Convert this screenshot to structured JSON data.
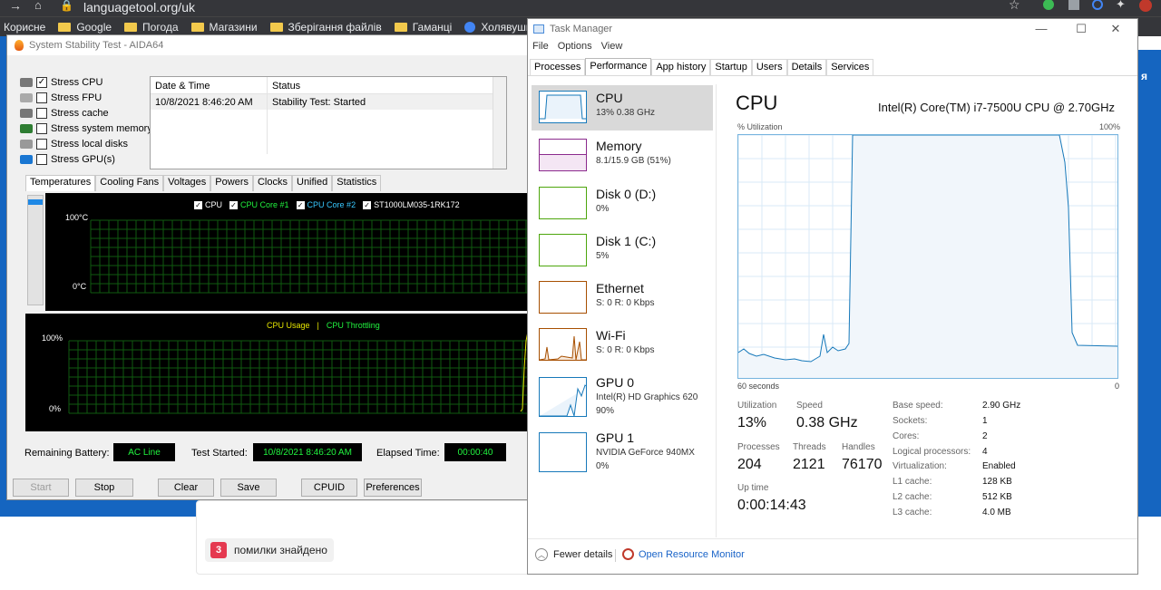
{
  "browser": {
    "url": "languagetool.org/uk",
    "bookmarks": [
      "Корисне",
      "Google",
      "Погода",
      "Магазини",
      "Зберігання файлів",
      "Гаманці",
      "Холявушка - Фор"
    ],
    "right_text": "я"
  },
  "languagetool": {
    "error_count": "3",
    "error_text": "помилки знайдено"
  },
  "aida": {
    "title": "System Stability Test - AIDA64",
    "stress": [
      {
        "label": "Stress CPU",
        "checked": true
      },
      {
        "label": "Stress FPU",
        "checked": false
      },
      {
        "label": "Stress cache",
        "checked": false
      },
      {
        "label": "Stress system memory",
        "checked": false
      },
      {
        "label": "Stress local disks",
        "checked": false
      },
      {
        "label": "Stress GPU(s)",
        "checked": false
      }
    ],
    "log": {
      "col_datetime": "Date & Time",
      "col_status": "Status",
      "row_datetime": "10/8/2021 8:46:20 AM",
      "row_status": "Stability Test: Started"
    },
    "tabs": [
      "Temperatures",
      "Cooling Fans",
      "Voltages",
      "Powers",
      "Clocks",
      "Unified",
      "Statistics"
    ],
    "temp_legend": [
      "CPU",
      "CPU Core #1",
      "CPU Core #2",
      "ST1000LM035-1RK172"
    ],
    "temp_axis": {
      "top": "100°C",
      "bottom": "0°C"
    },
    "usage_legend": {
      "usage": "CPU Usage",
      "sep": "|",
      "throttling": "CPU Throttling"
    },
    "usage_axis": {
      "top": "100%",
      "bottom": "0%"
    },
    "remaining_battery_label": "Remaining Battery:",
    "remaining_battery_value": "AC Line",
    "test_started_label": "Test Started:",
    "test_started_value": "10/8/2021 8:46:20 AM",
    "elapsed_label": "Elapsed Time:",
    "elapsed_value": "00:00:40",
    "buttons": {
      "start": "Start",
      "stop": "Stop",
      "clear": "Clear",
      "save": "Save",
      "cpuid": "CPUID",
      "preferences": "Preferences"
    }
  },
  "taskmanager": {
    "title": "Task Manager",
    "menu": [
      "File",
      "Options",
      "View"
    ],
    "tabs": [
      "Processes",
      "Performance",
      "App history",
      "Startup",
      "Users",
      "Details",
      "Services"
    ],
    "active_tab": "Performance",
    "sidebar": [
      {
        "name": "CPU",
        "sub": "13%  0.38 GHz",
        "color": "#1779ba"
      },
      {
        "name": "Memory",
        "sub": "8.1/15.9 GB (51%)",
        "color": "#8b2a8d"
      },
      {
        "name": "Disk 0 (D:)",
        "sub": "0%",
        "color": "#4da60c"
      },
      {
        "name": "Disk 1 (C:)",
        "sub": "5%",
        "color": "#4da60c"
      },
      {
        "name": "Ethernet",
        "sub": "S: 0 R: 0 Kbps",
        "color": "#a74f01"
      },
      {
        "name": "Wi-Fi",
        "sub": "S: 0 R: 0 Kbps",
        "color": "#a74f01"
      },
      {
        "name": "GPU 0",
        "sub": "Intel(R) HD Graphics 620",
        "sub2": "90%",
        "color": "#1779ba"
      },
      {
        "name": "GPU 1",
        "sub": "NVIDIA GeForce 940MX",
        "sub2": "0%",
        "color": "#1779ba"
      }
    ],
    "cpu": {
      "title": "CPU",
      "model": "Intel(R) Core(TM) i7-7500U CPU @ 2.70GHz",
      "util_label": "% Utilization",
      "util_max": "100%",
      "seconds_label": "60 seconds",
      "zero_label": "0",
      "utilization_label": "Utilization",
      "utilization": "13%",
      "speed_label": "Speed",
      "speed": "0.38 GHz",
      "processes_label": "Processes",
      "processes": "204",
      "threads_label": "Threads",
      "threads": "2121",
      "handles_label": "Handles",
      "handles": "76170",
      "uptime_label": "Up time",
      "uptime": "0:00:14:43",
      "details": [
        {
          "k": "Base speed:",
          "v": "2.90 GHz"
        },
        {
          "k": "Sockets:",
          "v": "1"
        },
        {
          "k": "Cores:",
          "v": "2"
        },
        {
          "k": "Logical processors:",
          "v": "4"
        },
        {
          "k": "Virtualization:",
          "v": "Enabled"
        },
        {
          "k": "L1 cache:",
          "v": "128 KB"
        },
        {
          "k": "L2 cache:",
          "v": "512 KB"
        },
        {
          "k": "L3 cache:",
          "v": "4.0 MB"
        }
      ]
    },
    "footer": {
      "fewer": "Fewer details",
      "resource_monitor": "Open Resource Monitor"
    }
  }
}
